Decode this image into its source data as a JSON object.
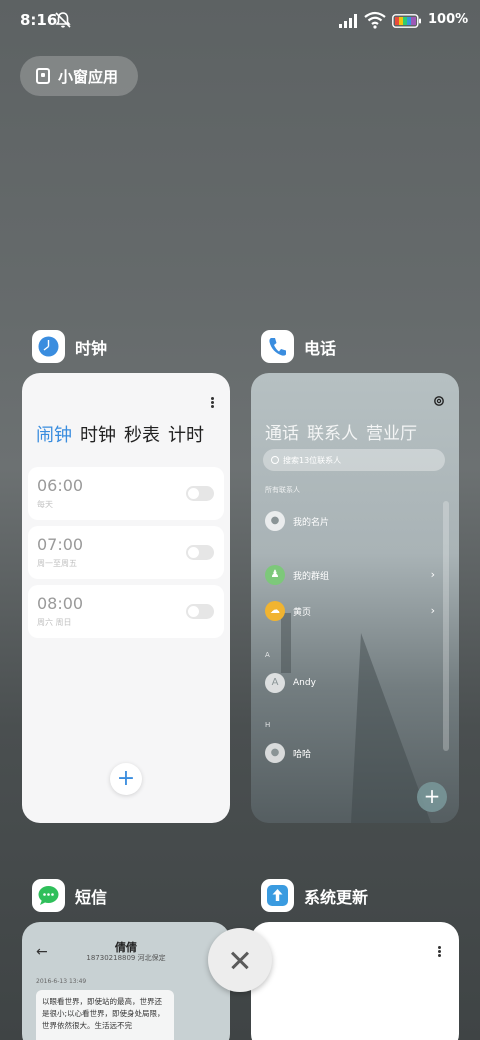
{
  "status_bar": {
    "time": "8:16",
    "battery_percent": "100%",
    "icons": [
      "bell-muted-icon",
      "signal-icon",
      "wifi-icon",
      "battery-icon"
    ]
  },
  "small_window_pill": {
    "label": "小窗应用",
    "icon": "window-icon"
  },
  "apps": {
    "clock": {
      "name": "时钟",
      "tabs": [
        "闹钟",
        "时钟",
        "秒表",
        "计时"
      ],
      "active_tab": "闹钟",
      "alarms": [
        {
          "time": "06:00",
          "repeat": "每天"
        },
        {
          "time": "07:00",
          "repeat": "周一至周五"
        },
        {
          "time": "08:00",
          "repeat": "周六 周日"
        }
      ],
      "add_label": "+"
    },
    "phone": {
      "name": "电话",
      "tabs": [
        "通话",
        "联系人",
        "营业厅"
      ],
      "search_placeholder": "搜索13位联系人",
      "all_contacts_label": "所有联系人",
      "contacts": [
        {
          "name": "我的名片",
          "avatar": ""
        },
        {
          "name": "我的群组",
          "avatar": ""
        },
        {
          "name": "黄页",
          "avatar": ""
        },
        {
          "section": "A",
          "name": "Andy",
          "avatar": "A"
        },
        {
          "section": "H",
          "name": "哈哈",
          "avatar": ""
        }
      ],
      "add_label": "+"
    },
    "sms": {
      "name": "短信",
      "contact_name": "倩倩",
      "contact_number": "18730218809 河北保定",
      "date": "2016-6-13 13:49",
      "message": "以眼看世界，即使站的最高，世界还是很小;以心看世界，即使身处局限，世界依然很大。生活远不完"
    },
    "update": {
      "name": "系统更新"
    }
  },
  "colors": {
    "accent": "#3a8ddf",
    "clock_icon": "#3a8ddf",
    "phone_icon": "#3a8ddf",
    "sms_icon": "#2fbf5a",
    "update_icon": "#3a9be0"
  }
}
